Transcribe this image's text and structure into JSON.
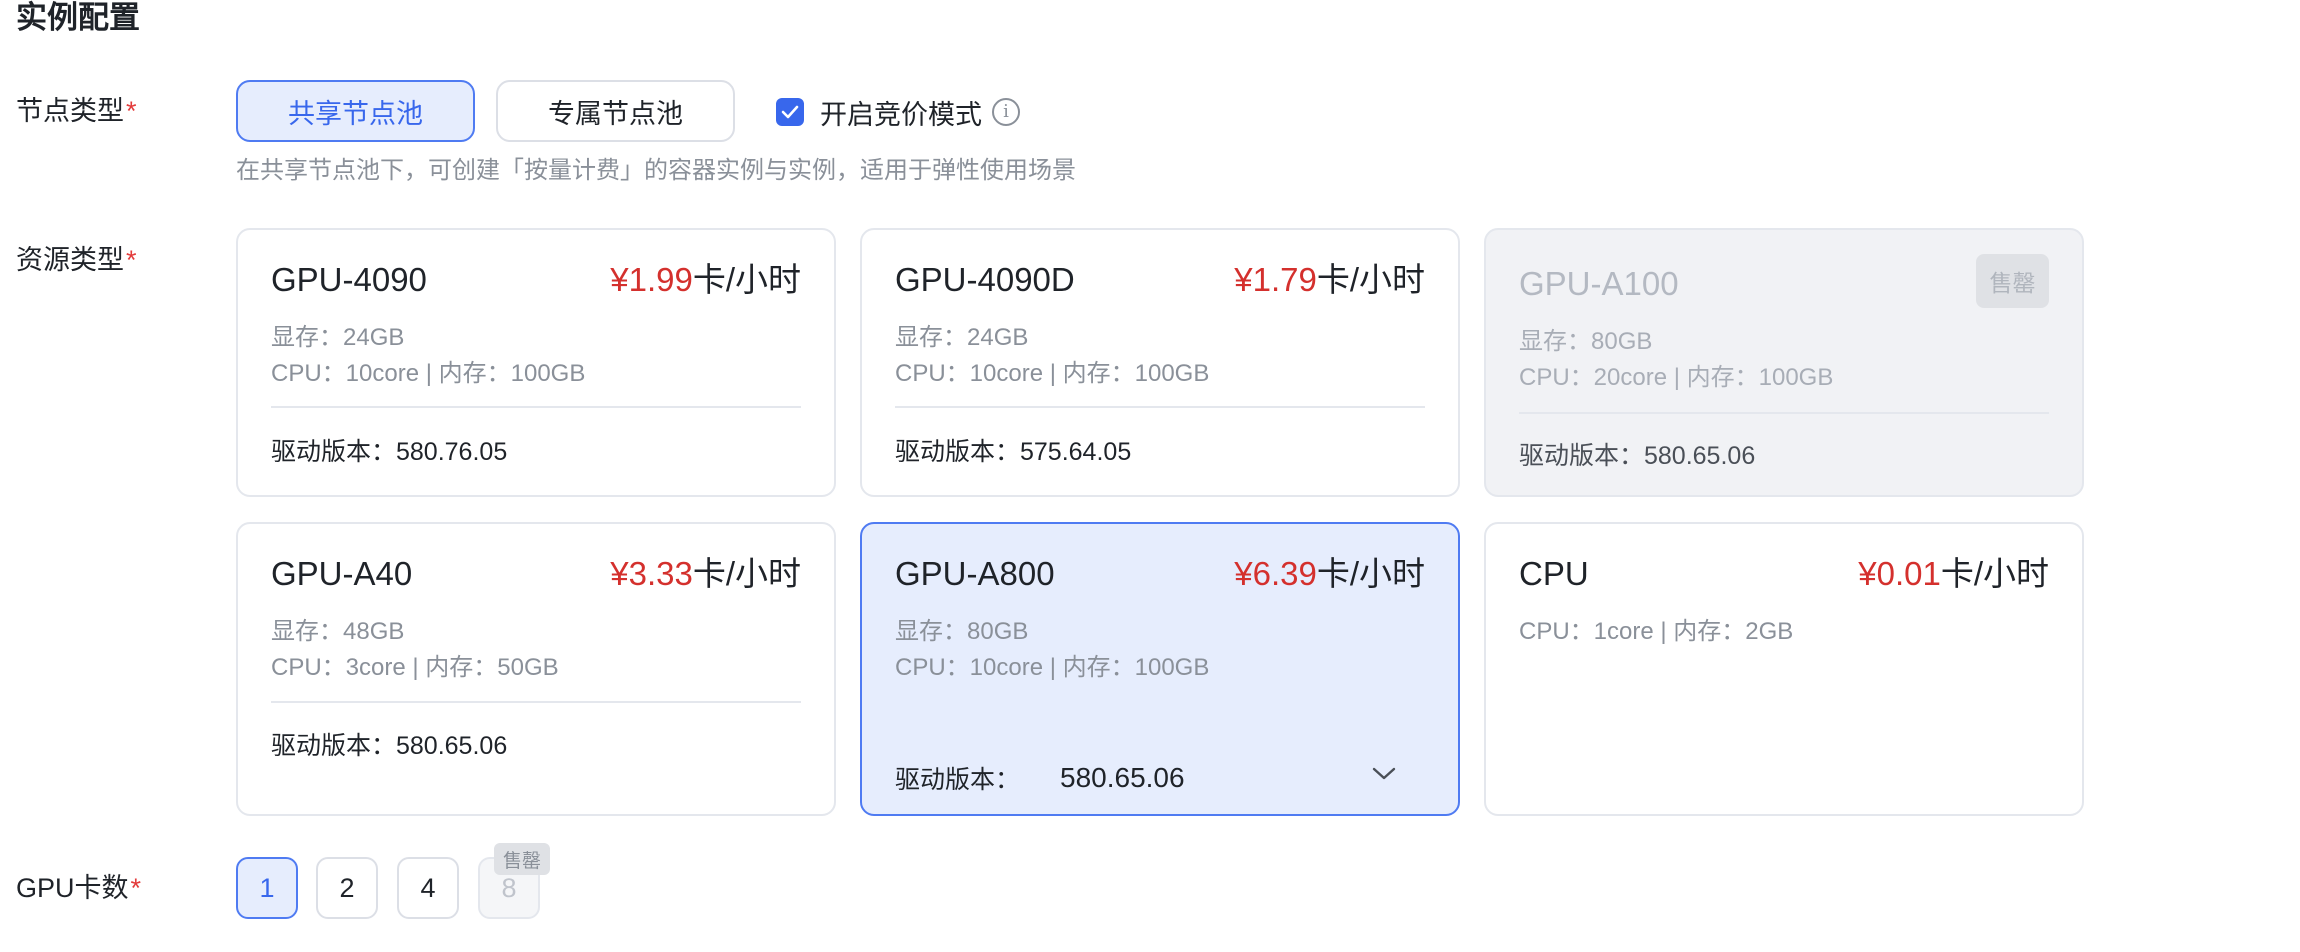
{
  "section_title": "实例配置",
  "required_mark": "*",
  "node_type": {
    "label": "节点类型",
    "options": [
      "共享节点池",
      "专属节点池"
    ],
    "selected": "共享节点池",
    "bid_mode_label": "开启竞价模式",
    "bid_mode_checked": true,
    "hint": "在共享节点池下，可创建「按量计费」的容器实例与实例，适用于弹性使用场景"
  },
  "resource_type": {
    "label": "资源类型",
    "cards": [
      {
        "name": "GPU-4090",
        "price": "¥1.99",
        "unit": "卡/小时",
        "vram": "显存：24GB",
        "cpu_mem": "CPU：10core | 内存：100GB",
        "driver": "驱动版本：580.76.05"
      },
      {
        "name": "GPU-4090D",
        "price": "¥1.79",
        "unit": "卡/小时",
        "vram": "显存：24GB",
        "cpu_mem": "CPU：10core | 内存：100GB",
        "driver": "驱动版本：575.64.05"
      },
      {
        "name": "GPU-A100",
        "status": "售罄",
        "vram": "显存：80GB",
        "cpu_mem": "CPU：20core | 内存：100GB",
        "driver": "驱动版本：580.65.06"
      },
      {
        "name": "GPU-A40",
        "price": "¥3.33",
        "unit": "卡/小时",
        "vram": "显存：48GB",
        "cpu_mem": "CPU：3core | 内存：50GB",
        "driver": "驱动版本：580.65.06"
      },
      {
        "name": "GPU-A800",
        "price": "¥6.39",
        "unit": "卡/小时",
        "vram": "显存：80GB",
        "cpu_mem": "CPU：10core | 内存：100GB",
        "driver_label": "驱动版本：",
        "driver_value": "580.65.06"
      },
      {
        "name": "CPU",
        "price": "¥0.01",
        "unit": "卡/小时",
        "cpu_mem": "CPU：1core | 内存：2GB"
      }
    ],
    "selected": "GPU-A800"
  },
  "gpu_count": {
    "label": "GPU卡数",
    "options": [
      "1",
      "2",
      "4",
      "8"
    ],
    "selected": "1",
    "sold_out_badge": "售罄"
  },
  "colors": {
    "accent": "#3867ec",
    "selected_bg": "#e6edfd",
    "price_red": "#d4302d",
    "required_red": "#e33b3b"
  }
}
